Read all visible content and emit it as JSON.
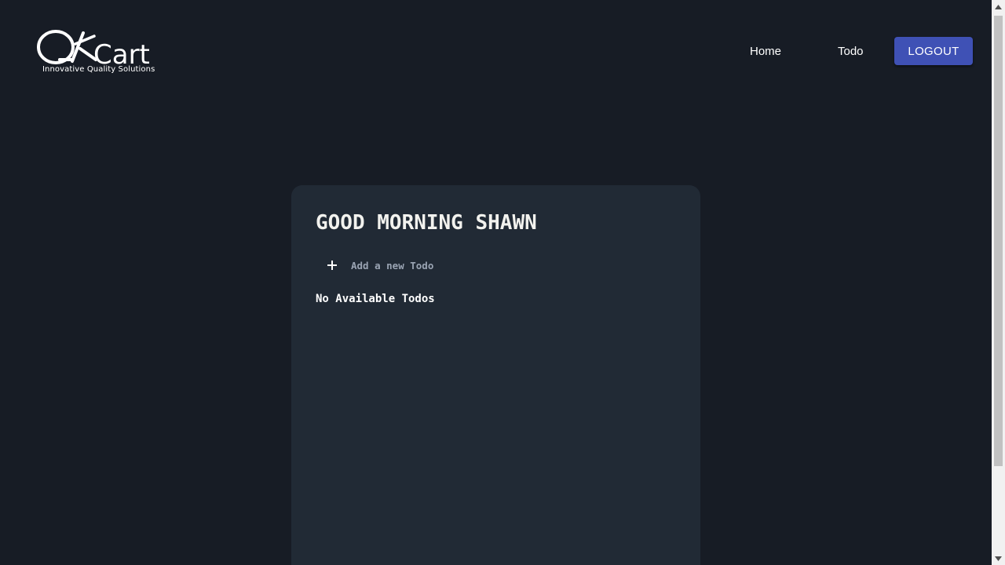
{
  "header": {
    "logo": {
      "wordmark": "QACart",
      "tagline": "Innovative Quality Solutions"
    },
    "nav": {
      "home_label": "Home",
      "todo_label": "Todo"
    },
    "logout_label": "LOGOUT",
    "logout_color": "#3f51b5"
  },
  "main": {
    "greeting": "GOOD MORNING SHAWN",
    "add_todo_label": "Add a new Todo",
    "add_icon": "plus-icon",
    "empty_message": "No Available Todos"
  },
  "theme": {
    "background": "#171c25",
    "card_background": "#212a35"
  }
}
